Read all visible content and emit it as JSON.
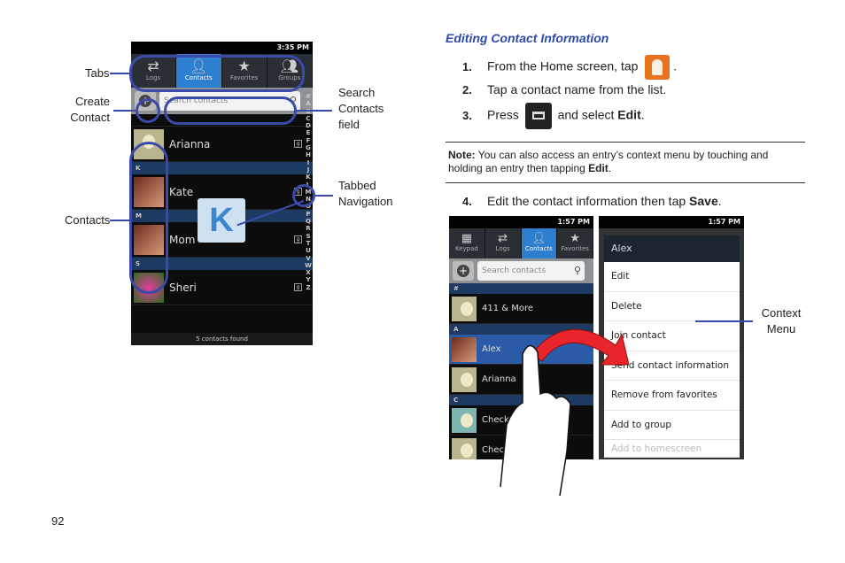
{
  "left_phone": {
    "status_time": "3:35 PM",
    "tabs": [
      {
        "label": "Logs",
        "icon": "arrows-icon"
      },
      {
        "label": "Contacts",
        "icon": "person-icon",
        "active": true
      },
      {
        "label": "Favorites",
        "icon": "star-icon"
      },
      {
        "label": "Groups",
        "icon": "group-icon"
      }
    ],
    "search_placeholder": "Search contacts",
    "contacts": [
      {
        "header": "",
        "name": "Arianna"
      },
      {
        "header": "K",
        "name": "Kate"
      },
      {
        "header": "M",
        "name": "Mom"
      },
      {
        "header": "S",
        "name": "Sheri"
      }
    ],
    "index": "#ABCDEFGHIJKLMNOPQRSTUVWXYZ",
    "footer": "5 contacts found",
    "popup_letter": "K"
  },
  "callouts": {
    "tabs": "Tabs",
    "create_contact": "Create Contact",
    "search_field": "Search Contacts field",
    "tabbed_navigation": "Tabbed Navigation",
    "contacts": "Contacts",
    "context_menu": "Context Menu"
  },
  "section": {
    "title": "Editing Contact Information",
    "steps": [
      {
        "num": "1.",
        "text": "From the Home screen, tap",
        "after": "."
      },
      {
        "num": "2.",
        "text": "Tap a contact name from the list."
      },
      {
        "num": "3.",
        "text": "Press",
        "mid": "and select",
        "bold": "Edit",
        "after": "."
      }
    ],
    "note_label": "Note:",
    "note_text": "You can also access an entry’s context menu by touching and holding an entry then tapping",
    "note_bold": "Edit",
    "note_end": ".",
    "step4": {
      "num": "4.",
      "text": "Edit the contact information then tap",
      "bold": "Save",
      "after": "."
    }
  },
  "right_phones": {
    "status_time": "1:57 PM",
    "tabs": [
      {
        "label": "Keypad"
      },
      {
        "label": "Logs"
      },
      {
        "label": "Contacts",
        "active": true
      },
      {
        "label": "Favorites"
      }
    ],
    "search_placeholder": "Search contacts",
    "contacts": [
      {
        "header": "#",
        "name": "411 & More"
      },
      {
        "header": "A",
        "name": "Alex"
      },
      {
        "header": "",
        "name": "Arianna"
      },
      {
        "header": "C",
        "name": "Check"
      },
      {
        "header": "",
        "name": "Check"
      }
    ],
    "menu_title": "Alex",
    "menu_items": [
      "Edit",
      "Delete",
      "Join contact",
      "Send contact information",
      "Remove from favorites",
      "Add to group",
      "Add to homescreen"
    ]
  },
  "page_number": "92",
  "colors": {
    "heading": "#2f4aa8",
    "callout": "#3b4aa8",
    "tab_active": "#2f7fd0"
  }
}
